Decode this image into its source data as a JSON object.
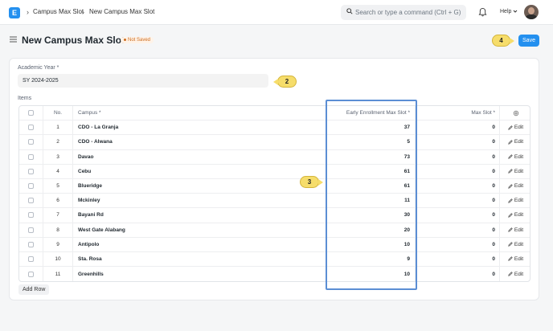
{
  "navbar": {
    "logo_letter": "E",
    "breadcrumbs": [
      "Campus Max Slot",
      "New Campus Max Slot"
    ],
    "search_placeholder": "Search or type a command (Ctrl + G)",
    "help_label": "Help"
  },
  "page": {
    "title": "New Campus Max Slot",
    "status": "Not Saved",
    "save_label": "Save"
  },
  "form": {
    "academic_year_label": "Academic Year *",
    "academic_year_value": "SY 2024-2025",
    "items_label": "Items"
  },
  "table": {
    "columns": {
      "no": "No.",
      "campus": "Campus *",
      "early": "Early Enrollment Max Slot *",
      "max": "Max Slot *"
    },
    "edit_label": "Edit",
    "rows": [
      {
        "no": "1",
        "campus": "CDO - La Granja",
        "early": "37",
        "max": "0"
      },
      {
        "no": "2",
        "campus": "CDO - Alwana",
        "early": "5",
        "max": "0"
      },
      {
        "no": "3",
        "campus": "Davao",
        "early": "73",
        "max": "0"
      },
      {
        "no": "4",
        "campus": "Cebu",
        "early": "61",
        "max": "0"
      },
      {
        "no": "5",
        "campus": "Blueridge",
        "early": "61",
        "max": "0"
      },
      {
        "no": "6",
        "campus": "Mckinley",
        "early": "11",
        "max": "0"
      },
      {
        "no": "7",
        "campus": "Bayani Rd",
        "early": "30",
        "max": "0"
      },
      {
        "no": "8",
        "campus": "West Gate Alabang",
        "early": "20",
        "max": "0"
      },
      {
        "no": "9",
        "campus": "Antipolo",
        "early": "10",
        "max": "0"
      },
      {
        "no": "10",
        "campus": "Sta. Rosa",
        "early": "9",
        "max": "0"
      },
      {
        "no": "11",
        "campus": "Greenhills",
        "early": "10",
        "max": "0"
      }
    ],
    "add_row_label": "Add Row"
  },
  "callouts": {
    "c2": "2",
    "c3": "3",
    "c4": "4"
  },
  "colors": {
    "accent": "#2490ef",
    "callout": "#f6dd6b",
    "highlight": "#5b8ed4",
    "status": "#cc6c1f"
  }
}
